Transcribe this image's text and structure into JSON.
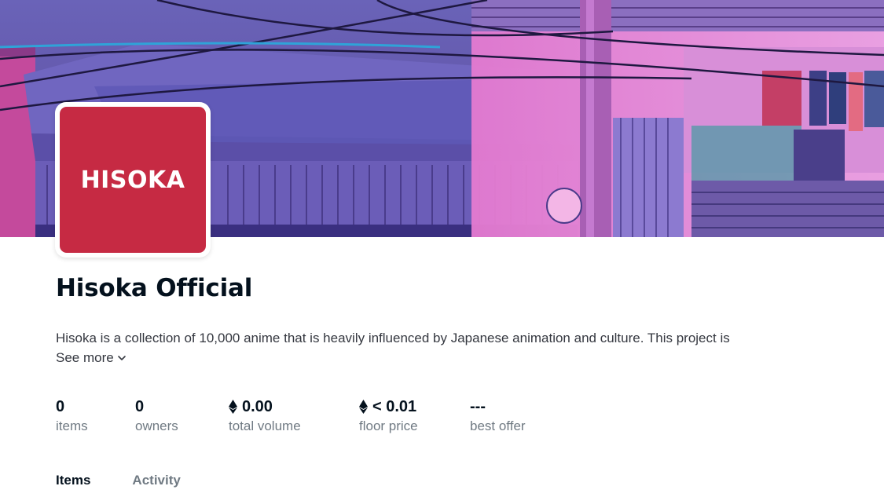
{
  "colors": {
    "avatar_bg": "#c62a43",
    "text_primary": "#04111d",
    "text_secondary": "#707a83"
  },
  "banner": {
    "image_icon": "anime-street-banner"
  },
  "collection": {
    "avatar_text": "HISOKA",
    "name": "Hisoka Official",
    "description": "Hisoka is a collection of 10,000 anime that is heavily influenced by Japanese animation and culture. This project is",
    "see_more": "See more"
  },
  "stats": {
    "items": {
      "value": "0",
      "label": "items"
    },
    "owners": {
      "value": "0",
      "label": "owners"
    },
    "total_volume": {
      "value": "0.00",
      "label": "total volume",
      "icon": "ethereum-icon"
    },
    "floor_price": {
      "value": "< 0.01",
      "label": "floor price",
      "icon": "ethereum-icon"
    },
    "best_offer": {
      "value": "---",
      "label": "best offer"
    }
  },
  "tabs": [
    {
      "label": "Items",
      "active": true
    },
    {
      "label": "Activity",
      "active": false
    }
  ]
}
